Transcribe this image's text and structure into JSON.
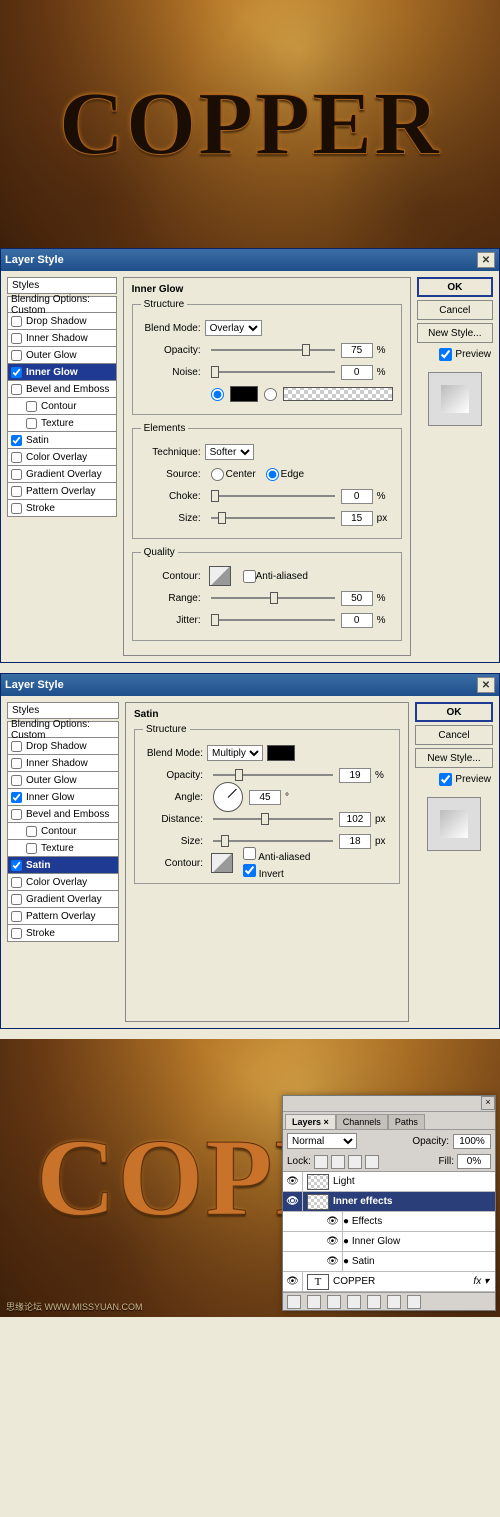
{
  "preview_text": "COPPER",
  "result_text": "COPP",
  "watermark": "思缘论坛  WWW.MISSYUAN.COM",
  "dialog1": {
    "title": "Layer Style",
    "styles_header": "Styles",
    "blending_label": "Blending Options: Custom",
    "items": [
      {
        "label": "Drop Shadow",
        "checked": false
      },
      {
        "label": "Inner Shadow",
        "checked": false
      },
      {
        "label": "Outer Glow",
        "checked": false
      },
      {
        "label": "Inner Glow",
        "checked": true,
        "selected": true
      },
      {
        "label": "Bevel and Emboss",
        "checked": false
      },
      {
        "label": "Contour",
        "checked": false,
        "indent": true
      },
      {
        "label": "Texture",
        "checked": false,
        "indent": true
      },
      {
        "label": "Satin",
        "checked": true
      },
      {
        "label": "Color Overlay",
        "checked": false
      },
      {
        "label": "Gradient Overlay",
        "checked": false
      },
      {
        "label": "Pattern Overlay",
        "checked": false
      },
      {
        "label": "Stroke",
        "checked": false
      }
    ],
    "panel": {
      "title": "Inner Glow",
      "structure": {
        "legend": "Structure",
        "blend_mode_label": "Blend Mode:",
        "blend_mode": "Overlay",
        "opacity_label": "Opacity:",
        "opacity": "75",
        "opacity_unit": "%",
        "noise_label": "Noise:",
        "noise": "0",
        "noise_unit": "%"
      },
      "elements": {
        "legend": "Elements",
        "technique_label": "Technique:",
        "technique": "Softer",
        "source_label": "Source:",
        "source_center": "Center",
        "source_edge": "Edge",
        "choke_label": "Choke:",
        "choke": "0",
        "choke_unit": "%",
        "size_label": "Size:",
        "size": "15",
        "size_unit": "px"
      },
      "quality": {
        "legend": "Quality",
        "contour_label": "Contour:",
        "aa_label": "Anti-aliased",
        "range_label": "Range:",
        "range": "50",
        "range_unit": "%",
        "jitter_label": "Jitter:",
        "jitter": "0",
        "jitter_unit": "%"
      }
    },
    "buttons": {
      "ok": "OK",
      "cancel": "Cancel",
      "new_style": "New Style...",
      "preview": "Preview"
    }
  },
  "dialog2": {
    "title": "Layer Style",
    "styles_header": "Styles",
    "blending_label": "Blending Options: Custom",
    "items": [
      {
        "label": "Drop Shadow",
        "checked": false
      },
      {
        "label": "Inner Shadow",
        "checked": false
      },
      {
        "label": "Outer Glow",
        "checked": false
      },
      {
        "label": "Inner Glow",
        "checked": true
      },
      {
        "label": "Bevel and Emboss",
        "checked": false
      },
      {
        "label": "Contour",
        "checked": false,
        "indent": true
      },
      {
        "label": "Texture",
        "checked": false,
        "indent": true
      },
      {
        "label": "Satin",
        "checked": true,
        "selected": true
      },
      {
        "label": "Color Overlay",
        "checked": false
      },
      {
        "label": "Gradient Overlay",
        "checked": false
      },
      {
        "label": "Pattern Overlay",
        "checked": false
      },
      {
        "label": "Stroke",
        "checked": false
      }
    ],
    "panel": {
      "title": "Satin",
      "structure": {
        "legend": "Structure",
        "blend_mode_label": "Blend Mode:",
        "blend_mode": "Multiply",
        "opacity_label": "Opacity:",
        "opacity": "19",
        "opacity_unit": "%",
        "angle_label": "Angle:",
        "angle": "45",
        "angle_unit": "°",
        "distance_label": "Distance:",
        "distance": "102",
        "distance_unit": "px",
        "size_label": "Size:",
        "size": "18",
        "size_unit": "px",
        "contour_label": "Contour:",
        "aa_label": "Anti-aliased",
        "invert_label": "Invert"
      }
    },
    "buttons": {
      "ok": "OK",
      "cancel": "Cancel",
      "new_style": "New Style...",
      "preview": "Preview"
    }
  },
  "layers": {
    "tabs": [
      "Layers ×",
      "Channels",
      "Paths"
    ],
    "mode": "Normal",
    "opacity_label": "Opacity:",
    "opacity": "100%",
    "lock_label": "Lock:",
    "fill_label": "Fill:",
    "fill": "0%",
    "rows": [
      {
        "name": "Light",
        "type": "layer"
      },
      {
        "name": "Inner effects",
        "type": "layer",
        "selected": true
      },
      {
        "name": "Effects",
        "type": "fx"
      },
      {
        "name": "Inner Glow",
        "type": "fx"
      },
      {
        "name": "Satin",
        "type": "fx"
      },
      {
        "name": "COPPER",
        "type": "text"
      }
    ],
    "fx_suffix": "fx"
  }
}
